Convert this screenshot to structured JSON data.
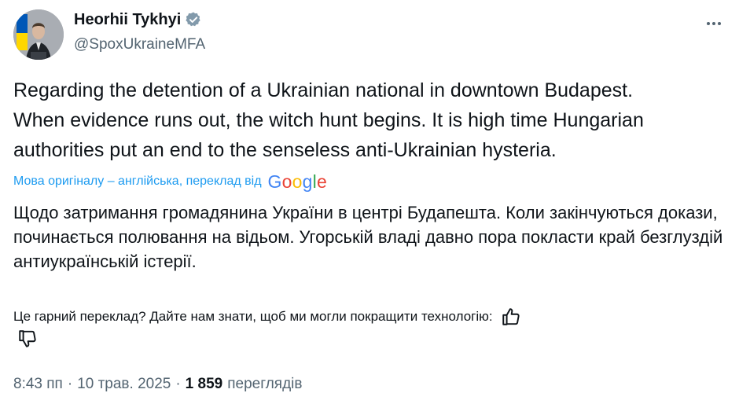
{
  "author": {
    "display_name": "Heorhii Tykhyi",
    "handle": "@SpoxUkraineMFA",
    "verified": true,
    "avatar_icon": "profile-photo",
    "flag_colors": [
      "#0057b7",
      "#ffd700"
    ]
  },
  "tweet": {
    "text": "Regarding the detention of a Ukrainian national in downtown Budapest.\nWhen evidence runs out, the witch hunt begins. It is high time Hungarian\nauthorities put an end to the senseless anti-Ukrainian hysteria."
  },
  "translation": {
    "note": "Мова оригіналу – англійська, переклад від",
    "provider": "Google",
    "text": "Щодо затримання громадянина України в центрі Будапешта. Коли закінчуються докази, починається полювання на відьом. Угорській владі давно пора покласти край безглуздій антиукраїнській істерії.",
    "feedback_prompt": "Це гарний переклад? Дайте нам знати, щоб ми могли покращити технологію:"
  },
  "meta": {
    "time": "8:43 пп",
    "date": "10 трав. 2025",
    "separator": "·",
    "views_count": "1 859",
    "views_label": "переглядів"
  },
  "colors": {
    "text_primary": "#0f1419",
    "text_secondary": "#536471",
    "link_blue": "#1d9bf0"
  }
}
